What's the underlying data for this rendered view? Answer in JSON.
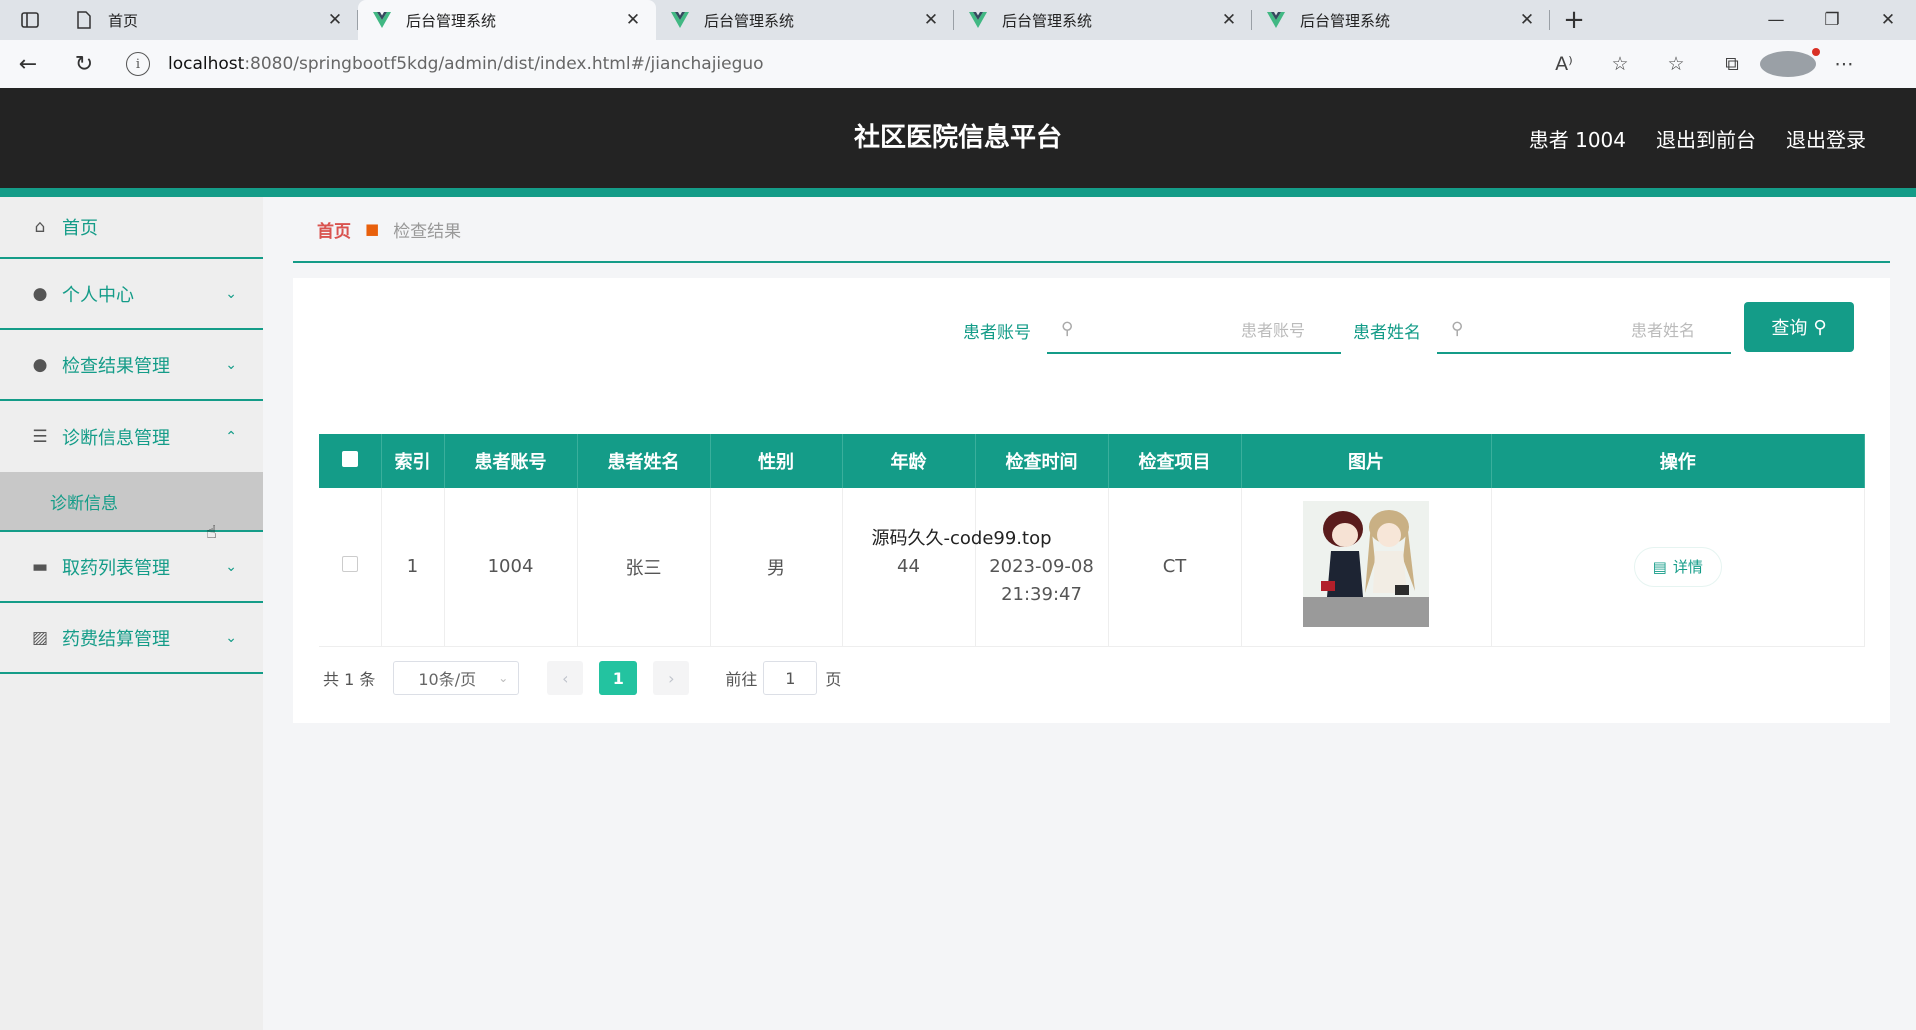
{
  "browser": {
    "tabs": [
      {
        "title": "首页"
      },
      {
        "title": "后台管理系统"
      },
      {
        "title": "后台管理系统"
      },
      {
        "title": "后台管理系统"
      },
      {
        "title": "后台管理系统"
      }
    ],
    "url_host": "localhost",
    "url_path": ":8080/springbootf5kdg/admin/dist/index.html#/jianchajieguo"
  },
  "header": {
    "title": "社区医院信息平台",
    "user": "患者 1004",
    "to_front": "退出到前台",
    "logout": "退出登录"
  },
  "sidebar": {
    "items": [
      {
        "label": "首页",
        "icon": "home-icon"
      },
      {
        "label": "个人中心",
        "icon": "user-icon"
      },
      {
        "label": "检查结果管理",
        "icon": "user-icon"
      },
      {
        "label": "诊断信息管理",
        "icon": "menu-icon",
        "sub": "诊断信息"
      },
      {
        "label": "取药列表管理",
        "icon": "print-icon"
      },
      {
        "label": "药费结算管理",
        "icon": "chart-icon"
      }
    ]
  },
  "breadcrumb": {
    "home": "首页",
    "current": "检查结果"
  },
  "search": {
    "account_label": "患者账号",
    "account_placeholder": "患者账号",
    "name_label": "患者姓名",
    "name_placeholder": "患者姓名",
    "button": "查询"
  },
  "table": {
    "headers": [
      "索引",
      "患者账号",
      "患者姓名",
      "性别",
      "年龄",
      "检查时间",
      "检查项目",
      "图片",
      "操作"
    ],
    "rows": [
      {
        "index": "1",
        "account": "1004",
        "name": "张三",
        "gender": "男",
        "age": "44",
        "time_overlay": "源码久久-code99.top",
        "date": "2023-09-08",
        "time": "21:39:47",
        "item": "CT",
        "action": "详情"
      }
    ]
  },
  "pager": {
    "total": "共 1 条",
    "size": "10条/页",
    "current": "1",
    "goto_label": "前往",
    "goto_value": "1",
    "page_label": "页"
  },
  "colors": {
    "accent": "#149c88",
    "header_bg": "#232323",
    "active_page": "#23c3a0"
  }
}
